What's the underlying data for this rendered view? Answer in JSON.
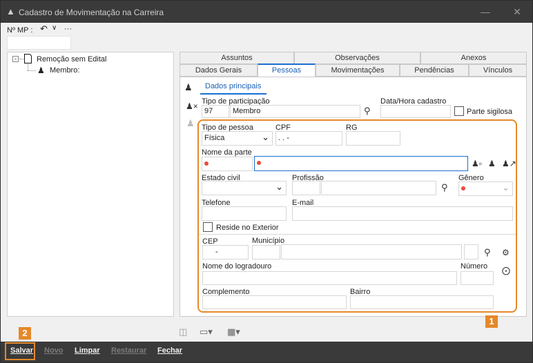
{
  "window": {
    "title": "Cadastro de Movimentação na Carreira"
  },
  "toolbar": {
    "mp_label": "Nº MP :",
    "undo_icon": "undo-icon",
    "more": "···"
  },
  "tree": {
    "root": "Remoção sem Edital",
    "child": "Membro:"
  },
  "tabs_top": [
    {
      "label": "Assuntos"
    },
    {
      "label": "Observações"
    },
    {
      "label": "Anexos"
    }
  ],
  "tabs_bottom": [
    {
      "label": "Dados Gerais"
    },
    {
      "label": "Pessoas"
    },
    {
      "label": "Movimentações"
    },
    {
      "label": "Pendências"
    },
    {
      "label": "Vínculos"
    }
  ],
  "subtab": "Dados principais",
  "form": {
    "tipo_participacao_label": "Tipo de participação",
    "tipo_participacao_code": "97",
    "tipo_participacao_value": "Membro",
    "data_hora_label": "Data/Hora cadastro",
    "parte_sigilosa_label": "Parte sigilosa",
    "tipo_pessoa_label": "Tipo de pessoa",
    "tipo_pessoa_value": "Física",
    "cpf_label": "CPF",
    "cpf_placeholder": " .  .  -",
    "rg_label": "RG",
    "nome_parte_label": "Nome da parte",
    "estado_civil_label": "Estado civil",
    "profissao_label": "Profissão",
    "genero_label": "Gênero",
    "telefone_label": "Telefone",
    "email_label": "E-mail",
    "reside_exterior_label": "Reside no Exterior",
    "cep_label": "CEP",
    "cep_value": "-",
    "municipio_label": "Município",
    "logradouro_label": "Nome do logradouro",
    "numero_label": "Número",
    "complemento_label": "Complemento",
    "bairro_label": "Bairro"
  },
  "annotations": {
    "badge1": "1",
    "badge2": "2"
  },
  "footer": {
    "salvar": "Salvar",
    "novo": "Novo",
    "limpar": "Limpar",
    "restaurar": "Restaurar",
    "fechar": "Fechar"
  },
  "colors": {
    "accent": "#1a6fd0",
    "highlight": "#e5892a",
    "required": "#e74c3c"
  }
}
